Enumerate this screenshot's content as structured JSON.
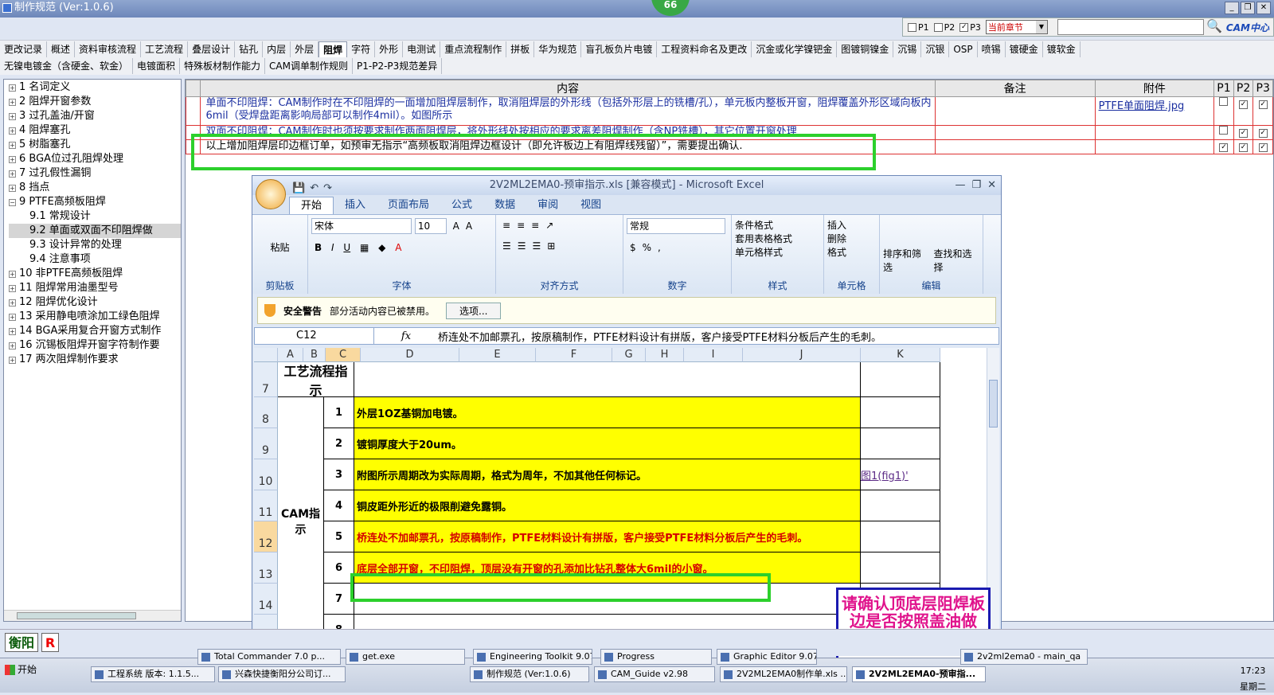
{
  "window": {
    "title": "制作规范 (Ver:1.0.6)",
    "badge": "66"
  },
  "search": {
    "p1": "P1",
    "p2": "P2",
    "p3": "P3",
    "scope": "当前章节",
    "logo": "CAM中心"
  },
  "tabs_row1": [
    "更改记录",
    "概述",
    "资料审核流程",
    "工艺流程",
    "叠层设计",
    "钻孔",
    "内层",
    "外层",
    "阻焊",
    "字符",
    "外形",
    "电测试",
    "重点流程制作",
    "拼板",
    "华为规范",
    "盲孔板负片电镀",
    "工程资料命名及更改",
    "沉金或化学镍钯金",
    "图镀铜镍金",
    "沉锡",
    "沉银",
    "OSP",
    "喷锡",
    "镀硬金",
    "镀软金"
  ],
  "tabs_row2": [
    "无镍电镀金（含硬金、软金）",
    "电镀面积",
    "特殊板材制作能力",
    "CAM调单制作规则",
    "P1-P2-P3规范差异"
  ],
  "active_tab": "阻焊",
  "tree": [
    {
      "label": "1 名词定义"
    },
    {
      "label": "2 阻焊开窗参数"
    },
    {
      "label": "3 过孔盖油/开窗"
    },
    {
      "label": "4 阻焊塞孔"
    },
    {
      "label": "5 树脂塞孔"
    },
    {
      "label": "6 BGA位过孔阻焊处理"
    },
    {
      "label": "7 过孔假性漏铜"
    },
    {
      "label": "8 挡点"
    },
    {
      "label": "9 PTFE高频板阻焊"
    },
    {
      "label": "9.1 常规设计",
      "sub": true
    },
    {
      "label": "9.2 单面或双面不印阻焊做",
      "sub": true,
      "sel": true
    },
    {
      "label": "9.3 设计异常的处理",
      "sub": true
    },
    {
      "label": "9.4 注意事项",
      "sub": true
    },
    {
      "label": "10 非PTFE高频板阻焊"
    },
    {
      "label": "11 阻焊常用油墨型号"
    },
    {
      "label": "12 阻焊优化设计"
    },
    {
      "label": "13 采用静电喷涂加工绿色阻焊"
    },
    {
      "label": "14 BGA采用复合开窗方式制作"
    },
    {
      "label": "16 沉锡板阻焊开窗字符制作要"
    },
    {
      "label": "17 两次阻焊制作要求"
    }
  ],
  "grid": {
    "headers": {
      "content": "内容",
      "note": "备注",
      "attach": "附件",
      "p1": "P1",
      "p2": "P2",
      "p3": "P3"
    },
    "rows": [
      {
        "content": "单面不印阻焊：CAM制作时在不印阻焊的一面增加阻焊层制作，取消阻焊层的外形线（包括外形层上的铣槽/孔），单元板内整板开窗，阻焊覆盖外形区域向板内6mil（受焊盘距离影响局部可以制作4mil）。如图所示",
        "attach": "PTFE单面阻焊.jpg",
        "p1": "",
        "p2": "✓",
        "p3": "✓"
      },
      {
        "content": "双面不印阻焊：CAM制作时也须按要求制作两面阻焊层，将外形线处按相应的要求离差阻焊制作（含NP铣槽），其它位置开窗处理",
        "attach": "",
        "p1": "",
        "p2": "✓",
        "p3": "✓"
      },
      {
        "content": "以上增加阻焊层印边框订单，如预审无指示“高频板取消阻焊边框设计（即允许板边上有阻焊线残留）”，需要提出确认.",
        "attach": "",
        "p1": "✓",
        "p2": "✓",
        "p3": "✓"
      }
    ]
  },
  "excel": {
    "title": "2V2ML2EMA0-预审指示.xls [兼容模式] - Microsoft Excel",
    "tabs": [
      "开始",
      "插入",
      "页面布局",
      "公式",
      "数据",
      "审阅",
      "视图"
    ],
    "clipboard": {
      "paste": "粘贴",
      "label": "剪贴板"
    },
    "font": {
      "name": "宋体",
      "size": "10",
      "label": "字体"
    },
    "align_label": "对齐方式",
    "number": {
      "format": "常规",
      "label": "数字"
    },
    "styles": {
      "cond": "条件格式",
      "table": "套用表格格式",
      "cell": "单元格样式",
      "label": "样式"
    },
    "cells": {
      "insert": "插入",
      "delete": "删除",
      "format": "格式",
      "label": "单元格"
    },
    "edit": {
      "sort": "排序和筛选",
      "find": "查找和选择",
      "label": "编辑"
    },
    "security": {
      "title": "安全警告",
      "msg": "部分活动内容已被禁用。",
      "btn": "选项..."
    },
    "namebox": "C12",
    "formula": "桥连处不加邮票孔，按原稿制作，PTFE材料设计有拼版，客户接受PTFE材料分板后产生的毛刺。",
    "cols": [
      "A",
      "B",
      "C",
      "D",
      "E",
      "F",
      "G",
      "H",
      "I",
      "J",
      "K"
    ],
    "row7_label": "工艺流程指示",
    "cam_label": "CAM指示",
    "rows": [
      {
        "n": "8",
        "idx": "1",
        "text": "外层1OZ基铜加电镀。",
        "red": false
      },
      {
        "n": "9",
        "idx": "2",
        "text": "镀铜厚度大于20um。",
        "red": false
      },
      {
        "n": "10",
        "idx": "3",
        "text": "附图所示周期改为实际周期，格式为周年，不加其他任何标记。",
        "red": false,
        "link": "图1(fig1)'"
      },
      {
        "n": "11",
        "idx": "4",
        "text": "铜皮距外形近的极限削避免露铜。",
        "red": false
      },
      {
        "n": "12",
        "idx": "5",
        "text": "桥连处不加邮票孔，按原稿制作，PTFE材料设计有拼版，客户接受PTFE材料分板后产生的毛刺。",
        "red": true
      },
      {
        "n": "13",
        "idx": "6",
        "text": "底层全部开窗，不印阻焊，顶层没有开窗的孔添加比钻孔整体大6mil的小窗。",
        "red": true
      },
      {
        "n": "14",
        "idx": "7",
        "text": "",
        "red": false
      },
      {
        "n": "",
        "idx": "8",
        "text": "",
        "red": false
      }
    ]
  },
  "note_text": "请确认顶底层阻焊板边是否按照盖油做",
  "bottom": {
    "city": "衡阳",
    "r": "R"
  },
  "taskbar": {
    "start": "开始",
    "row1": [
      "Total Commander 7.0 p...",
      "get.exe",
      "Engineering Toolkit 9.07...",
      "Progress",
      "Graphic Editor 9.07b2",
      "2v2ml2ema0 - main_qa"
    ],
    "row2": [
      "工程系统 版本: 1.1.5...",
      "兴森快捷衡阳分公司订...",
      "制作规范 (Ver:1.0.6)",
      "CAM_Guide v2.98",
      "2V2ML2EMA0制作单.xls ...",
      "2V2ML2EMA0-预审指..."
    ],
    "time": "17:23",
    "day": "星期二"
  }
}
